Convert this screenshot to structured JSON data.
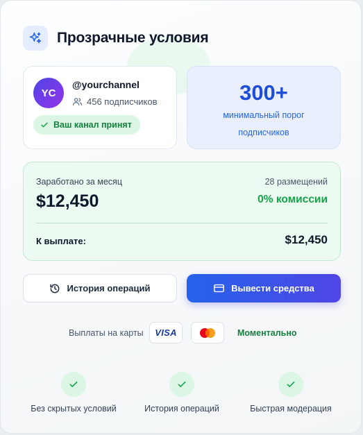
{
  "header": {
    "title": "Прозрачные условия",
    "icon": "sparkles-icon",
    "accent": "#2563eb"
  },
  "channel": {
    "avatar_initials": "YC",
    "handle": "@yourchannel",
    "subscribers": "456 подписчиков",
    "status": "Ваш канал принят"
  },
  "threshold": {
    "value": "300+",
    "label": "минимальный порог подписчиков"
  },
  "earnings": {
    "label": "Заработано за месяц",
    "value": "$12,450",
    "placements": "28 размещений",
    "commission": "0% комиссии",
    "payout_label": "К выплате:",
    "payout_value": "$12,450"
  },
  "actions": {
    "history": "История операций",
    "withdraw": "Вывести средства"
  },
  "payouts": {
    "label": "Выплаты на карты",
    "visa": "VISA",
    "instant": "Моментально"
  },
  "features": [
    "Без скрытых условий",
    "История операций",
    "Быстрая модерация"
  ],
  "colors": {
    "success": "#16a34a",
    "primary": "#2563eb",
    "success_bg": "#ecfaf1"
  }
}
